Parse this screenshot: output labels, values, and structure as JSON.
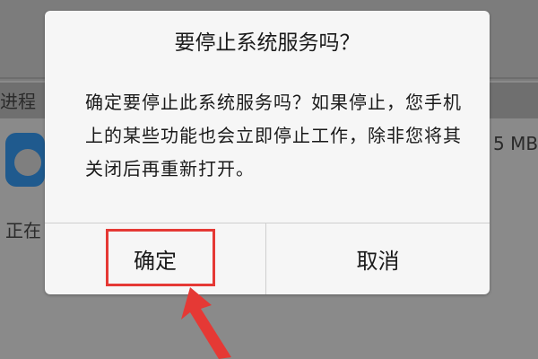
{
  "background": {
    "section_label": "进程",
    "size_text": "5 MB",
    "running_text": "正在"
  },
  "dialog": {
    "title": "要停止系统服务吗？",
    "message": "确定要停止此系统服务吗？如果停止，您手机上的某些功能也会立即停止工作，除非您将其关闭后再重新打开。",
    "confirm_label": "确定",
    "cancel_label": "取消"
  },
  "annotation": {
    "highlight_color": "#e53935"
  },
  "colors": {
    "dialog_bg": "#f6f6f6",
    "overlay_bg": "#8a8a8a",
    "text": "#1a1a1a"
  }
}
